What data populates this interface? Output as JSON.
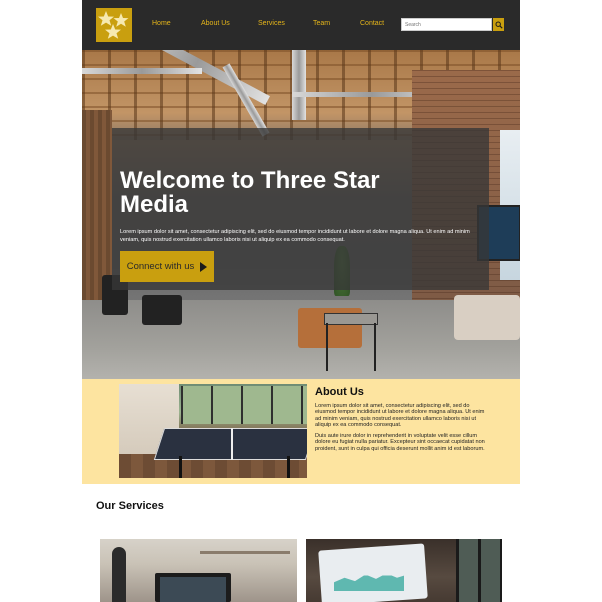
{
  "header": {
    "nav": [
      "Home",
      "About Us",
      "Services",
      "Team",
      "Contact"
    ],
    "search_placeholder": "Search"
  },
  "hero": {
    "title": "Welcome to Three Star Media",
    "body": "Lorem ipsum dolor sit amet, consectetur adipiscing elit, sed do eiusmod tempor incididunt ut labore et dolore magna aliqua. Ut enim ad minim veniam, quis nostrud exercitation ullamco laboris nisi ut aliquip ex ea commodo consequat.",
    "cta_label": "Connect with us"
  },
  "about": {
    "title": "About Us",
    "p1": "Lorem ipsum dolor sit amet, consectetur adipiscing elit, sed do eiusmod tempor incididunt ut labore et dolore magna aliqua. Ut enim ad minim veniam, quis nostrud exercitation ullamco laboris nisi ut aliquip ex ea commodo consequat.",
    "p2": "Duis aute irure dolor in reprehenderit in voluptate velit esse cillum dolore eu fugiat nulla pariatur. Excepteur sint occaecat cupidatat non proident, sunt in culpa qui officia deserunt mollit anim id est laborum."
  },
  "services": {
    "title": "Our Services"
  },
  "colors": {
    "header_bg": "#2a2a2a",
    "accent": "#c99f0f",
    "about_bg": "#fde4a0"
  },
  "icons": {
    "logo": "three-stars-logo",
    "search": "search-icon",
    "cta": "play-arrow-icon"
  }
}
